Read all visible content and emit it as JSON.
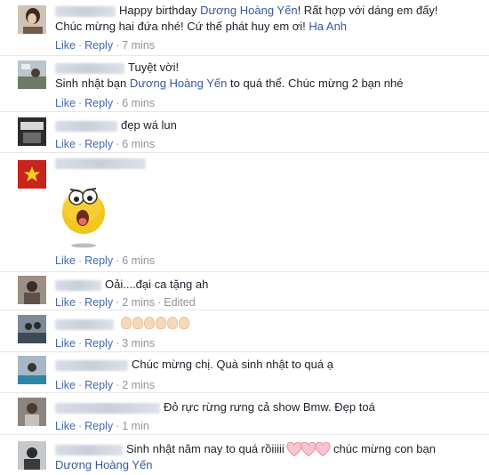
{
  "comments": [
    {
      "lines": [
        "Happy birthday ",
        "Dương Hoàng Yến",
        "! Rất hợp với dáng em đấy!",
        "Chúc mừng hai đứa nhé! Cứ thế phát huy em ơi! ",
        "Ha Anh"
      ],
      "like": "Like",
      "reply": "Reply",
      "time": "7 mins"
    },
    {
      "lines": [
        "Tuyệt vời!",
        "Sinh nhật bạn ",
        "Dương Hoàng Yến",
        " to quá thể. Chúc mừng 2 bạn nhé"
      ],
      "like": "Like",
      "reply": "Reply",
      "time": "6 mins"
    },
    {
      "lines": [
        "đẹp wá lun"
      ],
      "like": "Like",
      "reply": "Reply",
      "time": "6 mins"
    },
    {
      "sticker": "surprised-face-sticker",
      "like": "Like",
      "reply": "Reply",
      "time": "6 mins"
    },
    {
      "lines": [
        "Oải....đại ca tặng ah"
      ],
      "like": "Like",
      "reply": "Reply",
      "time": "2 mins",
      "edited": "Edited"
    },
    {
      "emoji": "clapping-hands",
      "like": "Like",
      "reply": "Reply",
      "time": "3 mins"
    },
    {
      "lines": [
        "Chúc mừng chị. Quà sinh nhật to quá ạ"
      ],
      "like": "Like",
      "reply": "Reply",
      "time": "2 mins"
    },
    {
      "lines": [
        "Đỏ rực rừng rưng cả show Bmw. Đẹp toá"
      ],
      "like": "Like",
      "reply": "Reply",
      "time": "1 min"
    },
    {
      "lines": [
        "Sinh nhật năm nay to quá rồiiiii",
        "chúc mừng con bạn",
        "Dương Hoàng Yến"
      ]
    }
  ],
  "colors": {
    "link": "#4267b2",
    "mention": "#365899",
    "meta": "#90949c",
    "divider": "#e5e6e9"
  }
}
